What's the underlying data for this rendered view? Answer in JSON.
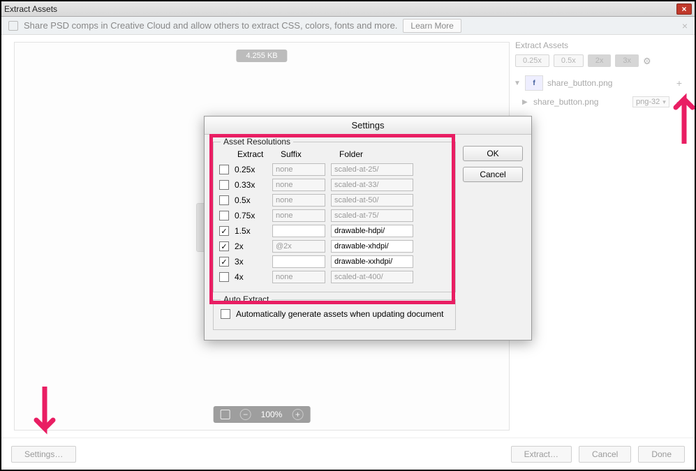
{
  "window": {
    "title": "Extract Assets"
  },
  "banner": {
    "text": "Share PSD comps in Creative Cloud and allow others to extract CSS, colors, fonts and more.",
    "learn": "Learn More"
  },
  "preview": {
    "filesize": "4.255 KB",
    "zoom": "100%"
  },
  "side": {
    "header": "Extract Assets",
    "scales": [
      "0.25x",
      "0.5x",
      "2x",
      "3x"
    ],
    "asset1": {
      "name": "share_button.png"
    },
    "asset2": {
      "name": "share_button.png",
      "format": "png-32"
    }
  },
  "bottom": {
    "settings": "Settings…",
    "extract": "Extract…",
    "cancel": "Cancel",
    "done": "Done"
  },
  "dialog": {
    "title": "Settings",
    "group_res": "Asset Resolutions",
    "hdr_extract": "Extract",
    "hdr_suffix": "Suffix",
    "hdr_folder": "Folder",
    "rows": [
      {
        "checked": false,
        "scale": "0.25x",
        "suffix": "none",
        "suffix_muted": true,
        "folder": "scaled-at-25/",
        "folder_muted": true
      },
      {
        "checked": false,
        "scale": "0.33x",
        "suffix": "none",
        "suffix_muted": true,
        "folder": "scaled-at-33/",
        "folder_muted": true
      },
      {
        "checked": false,
        "scale": "0.5x",
        "suffix": "none",
        "suffix_muted": true,
        "folder": "scaled-at-50/",
        "folder_muted": true
      },
      {
        "checked": false,
        "scale": "0.75x",
        "suffix": "none",
        "suffix_muted": true,
        "folder": "scaled-at-75/",
        "folder_muted": true
      },
      {
        "checked": true,
        "scale": "1.5x",
        "suffix": "",
        "suffix_muted": false,
        "folder": "drawable-hdpi/",
        "folder_muted": false
      },
      {
        "checked": true,
        "scale": "2x",
        "suffix": "@2x",
        "suffix_muted": true,
        "folder": "drawable-xhdpi/",
        "folder_muted": false
      },
      {
        "checked": true,
        "scale": "3x",
        "suffix": "",
        "suffix_muted": false,
        "folder": "drawable-xxhdpi/",
        "folder_muted": false
      },
      {
        "checked": false,
        "scale": "4x",
        "suffix": "none",
        "suffix_muted": true,
        "folder": "scaled-at-400/",
        "folder_muted": true
      }
    ],
    "group_auto": "Auto Extract",
    "auto_label": "Automatically generate assets when updating document",
    "ok": "OK",
    "cancel": "Cancel"
  }
}
